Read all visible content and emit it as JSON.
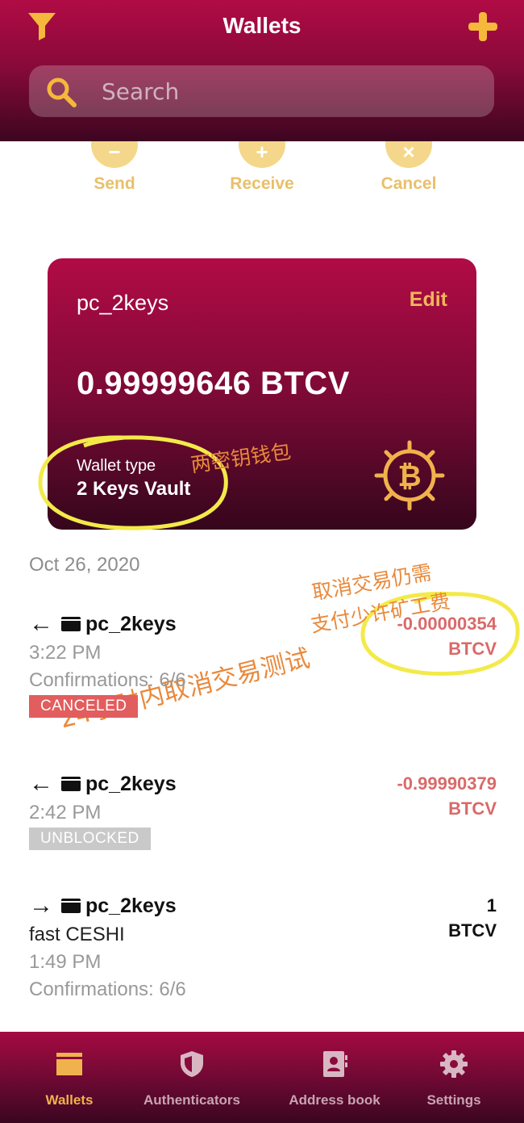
{
  "header": {
    "title": "Wallets",
    "search_placeholder": "Search",
    "filter_icon": "filter-icon",
    "add_icon": "plus-icon",
    "accent_color": "#f5b83b"
  },
  "actions": [
    {
      "label": "Send",
      "symbol": "−"
    },
    {
      "label": "Receive",
      "symbol": "+"
    },
    {
      "label": "Cancel",
      "symbol": "×"
    }
  ],
  "wallet_card": {
    "name": "pc_2keys",
    "edit_label": "Edit",
    "balance": "0.99999646 BTCV",
    "type_label": "Wallet type",
    "type_value": "2 Keys Vault",
    "logo_icon": "bitcoin-vault-icon"
  },
  "annotations": {
    "wallet_type_note": "两密钥钱包",
    "fee_note_line1": "取消交易仍需",
    "fee_note_line2": "支付少许矿工费",
    "test_note": "24小时内取消交易测试"
  },
  "transactions": {
    "date_header": "Oct 26, 2020",
    "items": [
      {
        "direction": "←",
        "wallet": "pc_2keys",
        "time": "3:22 PM",
        "confirmations": "Confirmations: 6/6",
        "badge": "CANCELED",
        "amount_value": "-0.00000354",
        "amount_unit": "BTCV"
      },
      {
        "direction": "←",
        "wallet": "pc_2keys",
        "time": "2:42 PM",
        "badge": "UNBLOCKED",
        "amount_value": "-0.99990379",
        "amount_unit": "BTCV"
      },
      {
        "direction": "→",
        "wallet": "pc_2keys",
        "memo": "fast CESHI",
        "time": "1:49 PM",
        "confirmations": "Confirmations: 6/6",
        "amount_value": "1",
        "amount_unit": "BTCV"
      }
    ]
  },
  "bottom_nav": [
    {
      "label": "Wallets",
      "icon": "wallet-icon",
      "active": true
    },
    {
      "label": "Authenticators",
      "icon": "shield-icon",
      "active": false
    },
    {
      "label": "Address book",
      "icon": "address-book-icon",
      "active": false
    },
    {
      "label": "Settings",
      "icon": "gear-icon",
      "active": false
    }
  ],
  "colors": {
    "brand_crimson": "#b10b45",
    "brand_dark": "#3d0620",
    "gold": "#f0b24c",
    "negative_amount": "#d96a6a",
    "canceled_badge": "#e25d5d",
    "unblocked_badge": "#c9c9c9",
    "annotation": "#e9893c",
    "highlight_ring": "#f3ea4a"
  }
}
